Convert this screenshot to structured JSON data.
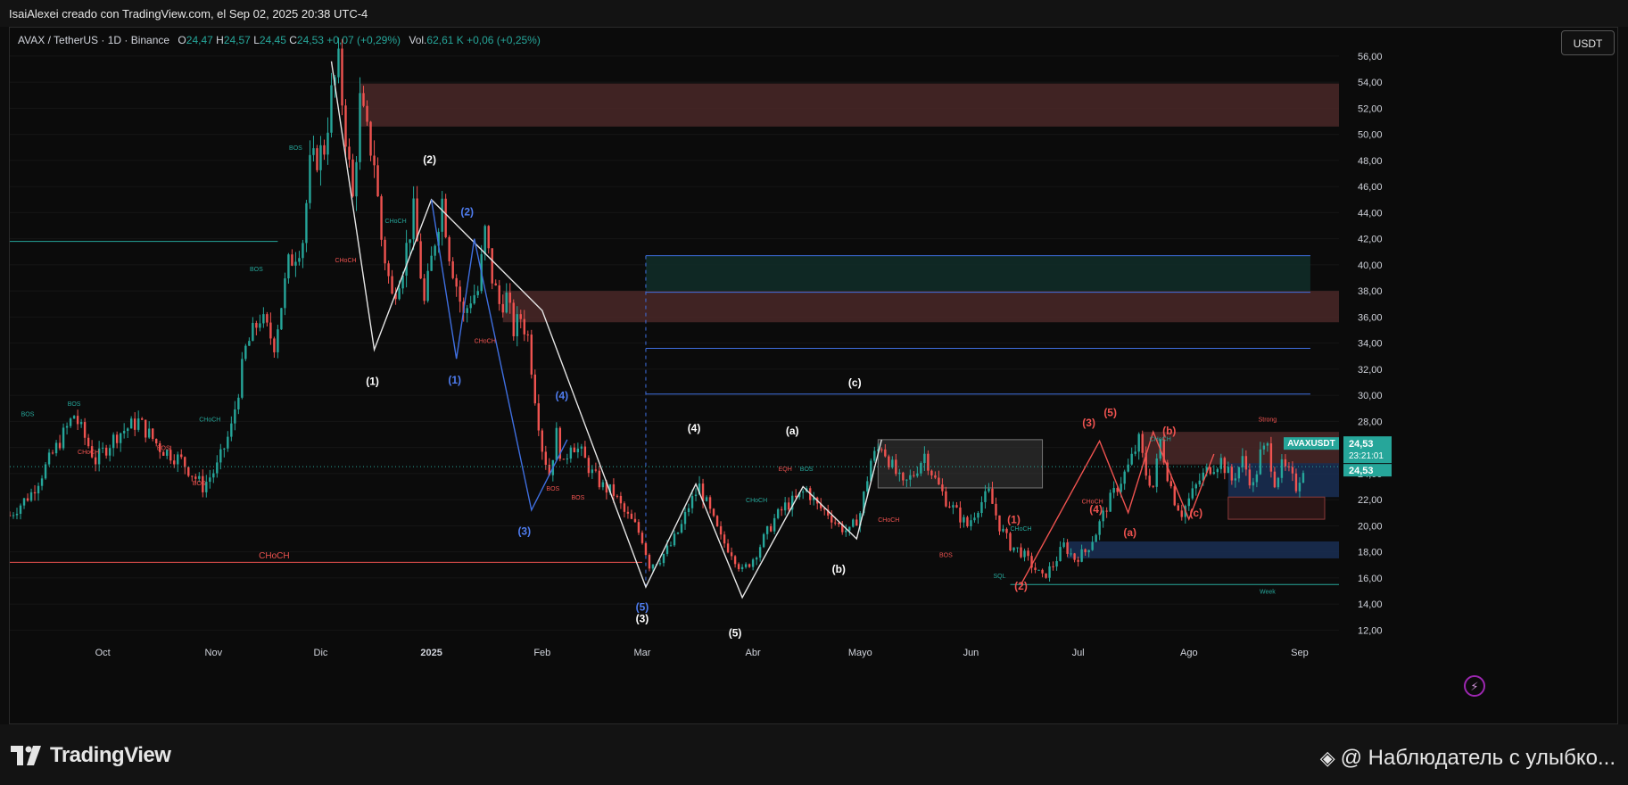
{
  "header": {
    "attribution": "IsaiAlexei creado con TradingView.com, el Sep 02, 2025 20:38 UTC-4"
  },
  "legend": {
    "symbol": "AVAX / TetherUS · 1D · Binance",
    "o_label": "O",
    "o_value": "24,47",
    "h_label": "H",
    "h_value": "24,57",
    "l_label": "L",
    "l_value": "24,45",
    "c_label": "C",
    "c_value": "24,53",
    "change": "+0,07 (+0,29%)",
    "vol_label": "Vol.",
    "vol_value": "62,61 K",
    "vol_change": "+0,06 (+0,25%)"
  },
  "currency_button": "USDT",
  "price_tags": {
    "symbol": "AVAXUSDT",
    "price": "24,53",
    "countdown": "23:21:01",
    "price2": "24,53"
  },
  "footer": {
    "logo_text": "TradingView",
    "watermark": "@ Наблюдатель с улыбко..."
  },
  "colors": {
    "up": "#26a69a",
    "down": "#ef5350",
    "background": "#0b0b0b",
    "supply_zone": "#4a2828",
    "demand_zone": "#10302a",
    "blue_zone": "#1a2f55"
  },
  "chart_data": {
    "type": "candlestick",
    "ylim": [
      11,
      57.5
    ],
    "y_ticks": [
      12,
      14,
      16,
      18,
      20,
      22,
      24,
      26,
      28,
      30,
      32,
      34,
      36,
      38,
      40,
      42,
      44,
      46,
      48,
      50,
      52,
      54,
      56
    ],
    "y_tick_labels": [
      "12,00",
      "14,00",
      "16,00",
      "18,00",
      "20,00",
      "22,00",
      "24,00",
      "26,00",
      "28,00",
      "30,00",
      "32,00",
      "34,00",
      "36,00",
      "38,00",
      "40,00",
      "42,00",
      "44,00",
      "46,00",
      "48,00",
      "50,00",
      "52,00",
      "54,00",
      "56,00"
    ],
    "x_labels": [
      {
        "label": "Oct",
        "day": 26
      },
      {
        "label": "Nov",
        "day": 57
      },
      {
        "label": "Dic",
        "day": 87
      },
      {
        "label": "2025",
        "day": 118
      },
      {
        "label": "Feb",
        "day": 149
      },
      {
        "label": "Mar",
        "day": 177
      },
      {
        "label": "Abr",
        "day": 208
      },
      {
        "label": "Mayo",
        "day": 238
      },
      {
        "label": "Jun",
        "day": 269
      },
      {
        "label": "Jul",
        "day": 299
      },
      {
        "label": "Ago",
        "day": 330
      },
      {
        "label": "Sep",
        "day": 361
      }
    ],
    "last_price": 24.53,
    "close_path": [
      [
        0,
        20.8
      ],
      [
        6,
        22.5
      ],
      [
        12,
        25.5
      ],
      [
        18,
        28.5
      ],
      [
        24,
        25.0
      ],
      [
        30,
        27.0
      ],
      [
        36,
        28.0
      ],
      [
        42,
        26.0
      ],
      [
        48,
        25.0
      ],
      [
        54,
        23.0
      ],
      [
        58,
        24.5
      ],
      [
        62,
        27.5
      ],
      [
        66,
        33.5
      ],
      [
        70,
        36.0
      ],
      [
        74,
        34.0
      ],
      [
        78,
        40.0
      ],
      [
        82,
        42.0
      ],
      [
        84,
        47.5
      ],
      [
        88,
        49.0
      ],
      [
        90,
        53.0
      ],
      [
        92,
        55.3
      ],
      [
        94,
        50.0
      ],
      [
        96,
        45.0
      ],
      [
        98,
        52.5
      ],
      [
        100,
        50.0
      ],
      [
        102,
        48.0
      ],
      [
        104,
        42.0
      ],
      [
        107,
        37.5
      ],
      [
        110,
        40.0
      ],
      [
        113,
        44.0
      ],
      [
        116,
        37.0
      ],
      [
        119,
        42.0
      ],
      [
        121,
        45.0
      ],
      [
        123,
        41.0
      ],
      [
        125,
        38.5
      ],
      [
        127,
        36.0
      ],
      [
        129,
        37.5
      ],
      [
        131,
        38.0
      ],
      [
        133,
        42.5
      ],
      [
        135,
        39.0
      ],
      [
        137,
        37.0
      ],
      [
        139,
        37.5
      ],
      [
        141,
        35.0
      ],
      [
        143,
        36.0
      ],
      [
        145,
        34.5
      ],
      [
        147,
        30.0
      ],
      [
        149,
        26.0
      ],
      [
        151,
        24.0
      ],
      [
        153,
        27.0
      ],
      [
        155,
        24.5
      ],
      [
        157,
        26.5
      ],
      [
        160,
        25.5
      ],
      [
        163,
        24.0
      ],
      [
        166,
        23.0
      ],
      [
        169,
        22.5
      ],
      [
        172,
        21.0
      ],
      [
        175,
        20.0
      ],
      [
        177,
        19.0
      ],
      [
        179,
        17.0
      ],
      [
        182,
        17.5
      ],
      [
        185,
        18.5
      ],
      [
        188,
        20.0
      ],
      [
        190,
        21.5
      ],
      [
        193,
        23.0
      ],
      [
        196,
        21.0
      ],
      [
        199,
        19.0
      ],
      [
        202,
        18.0
      ],
      [
        205,
        16.5
      ],
      [
        208,
        17.5
      ],
      [
        211,
        19.0
      ],
      [
        214,
        20.5
      ],
      [
        217,
        21.5
      ],
      [
        220,
        22.0
      ],
      [
        223,
        22.8
      ],
      [
        226,
        21.5
      ],
      [
        229,
        21.0
      ],
      [
        232,
        20.0
      ],
      [
        235,
        19.5
      ],
      [
        238,
        21.0
      ],
      [
        241,
        25.0
      ],
      [
        244,
        26.2
      ],
      [
        247,
        24.5
      ],
      [
        250,
        23.0
      ],
      [
        253,
        24.0
      ],
      [
        256,
        25.5
      ],
      [
        259,
        23.5
      ],
      [
        262,
        22.0
      ],
      [
        265,
        21.0
      ],
      [
        268,
        20.0
      ],
      [
        271,
        21.5
      ],
      [
        274,
        22.5
      ],
      [
        277,
        20.0
      ],
      [
        280,
        18.5
      ],
      [
        283,
        18.0
      ],
      [
        286,
        17.0
      ],
      [
        289,
        16.0
      ],
      [
        292,
        17.0
      ],
      [
        295,
        18.5
      ],
      [
        298,
        17.5
      ],
      [
        301,
        18.0
      ],
      [
        304,
        19.5
      ],
      [
        307,
        21.5
      ],
      [
        310,
        23.0
      ],
      [
        313,
        24.5
      ],
      [
        316,
        26.5
      ],
      [
        318,
        24.0
      ],
      [
        320,
        23.0
      ],
      [
        322,
        26.5
      ],
      [
        324,
        24.0
      ],
      [
        326,
        22.0
      ],
      [
        328,
        21.0
      ],
      [
        330,
        22.0
      ],
      [
        333,
        23.5
      ],
      [
        336,
        24.5
      ],
      [
        339,
        25.0
      ],
      [
        342,
        23.5
      ],
      [
        345,
        25.0
      ],
      [
        348,
        23.0
      ],
      [
        350,
        25.5
      ],
      [
        352,
        26.0
      ],
      [
        354,
        23.5
      ],
      [
        356,
        24.5
      ],
      [
        358,
        24.0
      ],
      [
        360,
        23.0
      ],
      [
        362,
        24.53
      ]
    ],
    "zones": [
      {
        "type": "supply",
        "x0": 98,
        "x1": 372,
        "y0": 50.6,
        "y1": 53.9
      },
      {
        "type": "demand",
        "x0": 178,
        "x1": 364,
        "y0": 37.9,
        "y1": 40.7
      },
      {
        "type": "supply",
        "x0": 138,
        "x1": 372,
        "y0": 35.6,
        "y1": 38.0
      },
      {
        "type": "grey",
        "x0": 243,
        "x1": 289,
        "y0": 22.9,
        "y1": 26.6
      },
      {
        "type": "supply",
        "x0": 317,
        "x1": 372,
        "y0": 24.7,
        "y1": 27.2
      },
      {
        "type": "blue",
        "x0": 341,
        "x1": 372,
        "y0": 22.2,
        "y1": 24.8
      },
      {
        "type": "supply-outline",
        "x0": 341,
        "x1": 368,
        "y0": 20.5,
        "y1": 22.2
      },
      {
        "type": "blue",
        "x0": 296,
        "x1": 372,
        "y0": 17.5,
        "y1": 18.8
      }
    ],
    "lines": [
      {
        "color": "#26a69a",
        "x0": 0,
        "x1": 75,
        "y": 41.8
      },
      {
        "color": "#ef5350",
        "x0": 0,
        "x1": 177,
        "y": 17.2
      },
      {
        "color": "#3f6fe0",
        "x0": 178,
        "x1": 364,
        "y": 40.7
      },
      {
        "color": "#3f6fe0",
        "x0": 178,
        "x1": 364,
        "y": 37.9
      },
      {
        "color": "#3f6fe0",
        "x0": 178,
        "x1": 364,
        "y": 33.6
      },
      {
        "color": "#3f6fe0",
        "x0": 178,
        "x1": 364,
        "y": 30.1
      },
      {
        "color": "#26a69a",
        "x0": 280,
        "x1": 372,
        "y": 15.5
      }
    ],
    "wave_white": [
      [
        90,
        55.6
      ],
      [
        102,
        33.5
      ],
      [
        118,
        45.0
      ],
      [
        149,
        36.5
      ],
      [
        178,
        15.3
      ],
      [
        192,
        23.2
      ],
      [
        205,
        14.5
      ],
      [
        222,
        23.0
      ],
      [
        237,
        19.0
      ],
      [
        244,
        26.6
      ]
    ],
    "wave_blue": [
      [
        118,
        45.0
      ],
      [
        125,
        32.8
      ],
      [
        130,
        42.0
      ],
      [
        146,
        21.2
      ],
      [
        156,
        26.6
      ]
    ],
    "wave_red": [
      [
        283,
        15.5
      ],
      [
        305,
        26.5
      ],
      [
        313,
        21.0
      ],
      [
        320,
        27.2
      ],
      [
        330,
        20.5
      ],
      [
        337,
        25.5
      ]
    ],
    "wave_labels": [
      {
        "text": "(1)",
        "x": 101.5,
        "y": 30.8,
        "color": "#ffffff"
      },
      {
        "text": "(2)",
        "x": 117.5,
        "y": 47.8,
        "color": "#ffffff"
      },
      {
        "text": "(3)",
        "x": 177,
        "y": 12.6,
        "color": "#ffffff"
      },
      {
        "text": "(4)",
        "x": 191.5,
        "y": 27.2,
        "color": "#ffffff"
      },
      {
        "text": "(a)",
        "x": 219,
        "y": 27.0,
        "color": "#ffffff"
      },
      {
        "text": "(b)",
        "x": 232,
        "y": 16.4,
        "color": "#ffffff"
      },
      {
        "text": "(c)",
        "x": 236.5,
        "y": 30.7,
        "color": "#ffffff"
      },
      {
        "text": "(5)",
        "x": 203,
        "y": 11.5,
        "color": "#ffffff"
      },
      {
        "text": "(1)",
        "x": 124.5,
        "y": 30.9,
        "color": "#4f7df0"
      },
      {
        "text": "(2)",
        "x": 128,
        "y": 43.8,
        "color": "#4f7df0"
      },
      {
        "text": "(3)",
        "x": 144,
        "y": 19.3,
        "color": "#4f7df0"
      },
      {
        "text": "(4)",
        "x": 154.5,
        "y": 29.7,
        "color": "#4f7df0"
      },
      {
        "text": "(5)",
        "x": 177,
        "y": 13.5,
        "color": "#4f7df0"
      },
      {
        "text": "(1)",
        "x": 281,
        "y": 20.2,
        "color": "#ef5350"
      },
      {
        "text": "(2)",
        "x": 283,
        "y": 15.1,
        "color": "#ef5350"
      },
      {
        "text": "(3)",
        "x": 302,
        "y": 27.6,
        "color": "#ef5350"
      },
      {
        "text": "(4)",
        "x": 304,
        "y": 21.0,
        "color": "#ef5350"
      },
      {
        "text": "(5)",
        "x": 308,
        "y": 28.4,
        "color": "#ef5350"
      },
      {
        "text": "(a)",
        "x": 313.5,
        "y": 19.2,
        "color": "#ef5350"
      },
      {
        "text": "(b)",
        "x": 324.5,
        "y": 27.0,
        "color": "#ef5350"
      },
      {
        "text": "(c)",
        "x": 332,
        "y": 20.7,
        "color": "#ef5350"
      }
    ],
    "annotations": [
      {
        "text": "BOS",
        "x": 5,
        "y": 28.4,
        "color": "#26a69a"
      },
      {
        "text": "BOS",
        "x": 18,
        "y": 29.2,
        "color": "#26a69a"
      },
      {
        "text": "CHoCH",
        "x": 22,
        "y": 25.5,
        "color": "#ef5350"
      },
      {
        "text": "BOS",
        "x": 43,
        "y": 25.8,
        "color": "#ef5350"
      },
      {
        "text": "CHoCH",
        "x": 56,
        "y": 28.0,
        "color": "#26a69a"
      },
      {
        "text": "BOS",
        "x": 53,
        "y": 23.1,
        "color": "#ef5350"
      },
      {
        "text": "BOS",
        "x": 69,
        "y": 39.5,
        "color": "#26a69a"
      },
      {
        "text": "BOS",
        "x": 80,
        "y": 48.8,
        "color": "#26a69a"
      },
      {
        "text": "CHoCH",
        "x": 94,
        "y": 40.2,
        "color": "#ef5350"
      },
      {
        "text": "CHoCH",
        "x": 108,
        "y": 43.2,
        "color": "#26a69a"
      },
      {
        "text": "CHoCH",
        "x": 133,
        "y": 34.0,
        "color": "#ef5350"
      },
      {
        "text": "BOS",
        "x": 152,
        "y": 22.7,
        "color": "#ef5350"
      },
      {
        "text": "BOS",
        "x": 159,
        "y": 22.0,
        "color": "#ef5350"
      },
      {
        "text": "CHoCH",
        "x": 74,
        "y": 17.5,
        "color": "#ef5350",
        "size": 10
      },
      {
        "text": "CHoCH",
        "x": 209,
        "y": 21.8,
        "color": "#26a69a"
      },
      {
        "text": "EQH",
        "x": 217,
        "y": 24.2,
        "color": "#ef5350"
      },
      {
        "text": "BOS",
        "x": 223,
        "y": 24.2,
        "color": "#26a69a"
      },
      {
        "text": "CHoCH",
        "x": 246,
        "y": 20.3,
        "color": "#ef5350"
      },
      {
        "text": "BOS",
        "x": 262,
        "y": 17.6,
        "color": "#ef5350"
      },
      {
        "text": "SQL",
        "x": 277,
        "y": 16.0,
        "color": "#26a69a"
      },
      {
        "text": "CHoCH",
        "x": 283,
        "y": 19.6,
        "color": "#26a69a"
      },
      {
        "text": "CHoCH",
        "x": 303,
        "y": 21.7,
        "color": "#ef5350"
      },
      {
        "text": "CHoCH",
        "x": 322,
        "y": 26.5,
        "color": "#26a69a"
      },
      {
        "text": "Strong",
        "x": 352,
        "y": 28.0,
        "color": "#ef5350"
      },
      {
        "text": "Week",
        "x": 352,
        "y": 14.8,
        "color": "#26a69a"
      }
    ]
  }
}
